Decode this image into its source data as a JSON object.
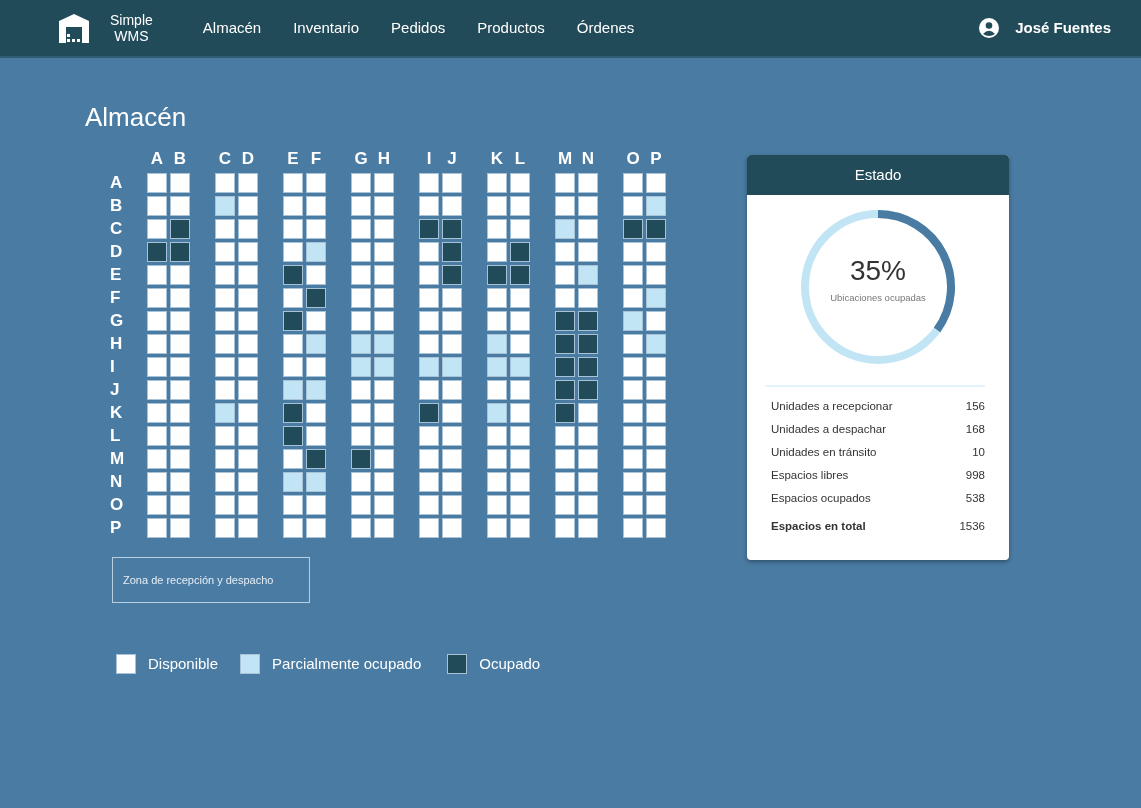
{
  "navbar": {
    "brand": [
      "Simple",
      "WMS"
    ],
    "links": [
      {
        "label": "Almacén",
        "selected": false
      },
      {
        "label": "Inventario",
        "selected": false
      },
      {
        "label": "Pedidos",
        "selected": false
      },
      {
        "label": "Productos",
        "selected": false
      },
      {
        "label": "Órdenes",
        "selected": false
      }
    ],
    "user": "José Fuentes"
  },
  "title": "Almacén",
  "grid": {
    "columns": [
      "A",
      "B",
      "C",
      "D",
      "E",
      "F",
      "G",
      "H",
      "I",
      "J",
      "K",
      "L",
      "M",
      "N",
      "O",
      "P"
    ],
    "rows": [
      {
        "label": "A",
        "cells": [
          {
            "color": "#ffffff"
          },
          {
            "color": "#ffffff"
          },
          {
            "color": "#ffffff"
          },
          {
            "color": "#ffffff"
          },
          {
            "color": "#ffffff"
          },
          {
            "color": "#ffffff"
          },
          {
            "color": "#ffffff"
          },
          {
            "color": "#ffffff"
          },
          {
            "color": "#ffffff"
          },
          {
            "color": "#ffffff"
          },
          {
            "color": "#ffffff"
          },
          {
            "color": "#ffffff"
          },
          {
            "color": "#ffffff"
          },
          {
            "color": "#ffffff"
          },
          {
            "color": "#ffffff"
          },
          {
            "color": "#ffffff"
          }
        ]
      },
      {
        "label": "B",
        "cells": [
          {
            "color": "#ffffff"
          },
          {
            "color": "#ffffff"
          },
          {
            "color": "#c2e5f6"
          },
          {
            "color": "#ffffff"
          },
          {
            "color": "#ffffff"
          },
          {
            "color": "#ffffff"
          },
          {
            "color": "#ffffff"
          },
          {
            "color": "#ffffff"
          },
          {
            "color": "#ffffff"
          },
          {
            "color": "#ffffff"
          },
          {
            "color": "#ffffff"
          },
          {
            "color": "#ffffff"
          },
          {
            "color": "#ffffff"
          },
          {
            "color": "#ffffff"
          },
          {
            "color": "#ffffff"
          },
          {
            "color": "#c2e5f6"
          }
        ]
      },
      {
        "label": "C",
        "cells": [
          {
            "color": "#ffffff"
          },
          {
            "color": "#224b5a"
          },
          {
            "color": "#ffffff"
          },
          {
            "color": "#ffffff"
          },
          {
            "color": "#ffffff"
          },
          {
            "color": "#ffffff"
          },
          {
            "color": "#ffffff"
          },
          {
            "color": "#ffffff"
          },
          {
            "color": "#224b5a"
          },
          {
            "color": "#224b5a"
          },
          {
            "color": "#ffffff"
          },
          {
            "color": "#ffffff"
          },
          {
            "color": "#c2e5f6"
          },
          {
            "color": "#ffffff"
          },
          {
            "color": "#224b5a"
          },
          {
            "color": "#224b5a"
          }
        ]
      },
      {
        "label": "D",
        "cells": [
          {
            "color": "#224b5a"
          },
          {
            "color": "#224b5a"
          },
          {
            "color": "#ffffff"
          },
          {
            "color": "#ffffff"
          },
          {
            "color": "#ffffff"
          },
          {
            "color": "#c2e5f6"
          },
          {
            "color": "#ffffff"
          },
          {
            "color": "#ffffff"
          },
          {
            "color": "#ffffff"
          },
          {
            "color": "#224b5a"
          },
          {
            "color": "#ffffff"
          },
          {
            "color": "#224b5a"
          },
          {
            "color": "#ffffff"
          },
          {
            "color": "#ffffff"
          },
          {
            "color": "#ffffff"
          },
          {
            "color": "#ffffff"
          }
        ]
      },
      {
        "label": "E",
        "cells": [
          {
            "color": "#ffffff"
          },
          {
            "color": "#ffffff"
          },
          {
            "color": "#ffffff"
          },
          {
            "color": "#ffffff"
          },
          {
            "color": "#224b5a"
          },
          {
            "color": "#ffffff"
          },
          {
            "color": "#ffffff"
          },
          {
            "color": "#ffffff"
          },
          {
            "color": "#ffffff"
          },
          {
            "color": "#224b5a"
          },
          {
            "color": "#224b5a"
          },
          {
            "color": "#224b5a"
          },
          {
            "color": "#ffffff"
          },
          {
            "color": "#c2e5f6"
          },
          {
            "color": "#ffffff"
          },
          {
            "color": "#ffffff"
          }
        ]
      },
      {
        "label": "F",
        "cells": [
          {
            "color": "#ffffff"
          },
          {
            "color": "#ffffff"
          },
          {
            "color": "#ffffff"
          },
          {
            "color": "#ffffff"
          },
          {
            "color": "#ffffff"
          },
          {
            "color": "#224b5a"
          },
          {
            "color": "#ffffff"
          },
          {
            "color": "#ffffff"
          },
          {
            "color": "#ffffff"
          },
          {
            "color": "#ffffff"
          },
          {
            "color": "#ffffff"
          },
          {
            "color": "#ffffff"
          },
          {
            "color": "#ffffff"
          },
          {
            "color": "#ffffff"
          },
          {
            "color": "#ffffff"
          },
          {
            "color": "#c2e5f6"
          }
        ]
      },
      {
        "label": "G",
        "cells": [
          {
            "color": "#ffffff"
          },
          {
            "color": "#ffffff"
          },
          {
            "color": "#ffffff"
          },
          {
            "color": "#ffffff"
          },
          {
            "color": "#224b5a"
          },
          {
            "color": "#ffffff"
          },
          {
            "color": "#ffffff"
          },
          {
            "color": "#ffffff"
          },
          {
            "color": "#ffffff"
          },
          {
            "color": "#ffffff"
          },
          {
            "color": "#ffffff"
          },
          {
            "color": "#ffffff"
          },
          {
            "color": "#224b5a"
          },
          {
            "color": "#224b5a"
          },
          {
            "color": "#c2e5f6"
          },
          {
            "color": "#ffffff"
          }
        ]
      },
      {
        "label": "H",
        "cells": [
          {
            "color": "#ffffff"
          },
          {
            "color": "#ffffff"
          },
          {
            "color": "#ffffff"
          },
          {
            "color": "#ffffff"
          },
          {
            "color": "#ffffff"
          },
          {
            "color": "#c2e5f6"
          },
          {
            "color": "#c2e5f6"
          },
          {
            "color": "#c2e5f6"
          },
          {
            "color": "#ffffff"
          },
          {
            "color": "#ffffff"
          },
          {
            "color": "#c2e5f6"
          },
          {
            "color": "#ffffff"
          },
          {
            "color": "#224b5a"
          },
          {
            "color": "#224b5a"
          },
          {
            "color": "#ffffff"
          },
          {
            "color": "#c2e5f6"
          }
        ]
      },
      {
        "label": "I",
        "cells": [
          {
            "color": "#ffffff"
          },
          {
            "color": "#ffffff"
          },
          {
            "color": "#ffffff"
          },
          {
            "color": "#ffffff"
          },
          {
            "color": "#ffffff"
          },
          {
            "color": "#ffffff"
          },
          {
            "color": "#c2e5f6"
          },
          {
            "color": "#c2e5f6"
          },
          {
            "color": "#c2e5f6"
          },
          {
            "color": "#c2e5f6"
          },
          {
            "color": "#c2e5f6"
          },
          {
            "color": "#c2e5f6"
          },
          {
            "color": "#224b5a"
          },
          {
            "color": "#224b5a"
          },
          {
            "color": "#ffffff"
          },
          {
            "color": "#ffffff"
          }
        ]
      },
      {
        "label": "J",
        "cells": [
          {
            "color": "#ffffff"
          },
          {
            "color": "#ffffff"
          },
          {
            "color": "#ffffff"
          },
          {
            "color": "#ffffff"
          },
          {
            "color": "#c2e5f6"
          },
          {
            "color": "#c2e5f6"
          },
          {
            "color": "#ffffff"
          },
          {
            "color": "#ffffff"
          },
          {
            "color": "#ffffff"
          },
          {
            "color": "#ffffff"
          },
          {
            "color": "#ffffff"
          },
          {
            "color": "#ffffff"
          },
          {
            "color": "#224b5a"
          },
          {
            "color": "#224b5a"
          },
          {
            "color": "#ffffff"
          },
          {
            "color": "#ffffff"
          }
        ]
      },
      {
        "label": "K",
        "cells": [
          {
            "color": "#ffffff"
          },
          {
            "color": "#ffffff"
          },
          {
            "color": "#c2e5f6"
          },
          {
            "color": "#ffffff"
          },
          {
            "color": "#224b5a"
          },
          {
            "color": "#ffffff"
          },
          {
            "color": "#ffffff"
          },
          {
            "color": "#ffffff"
          },
          {
            "color": "#224b5a"
          },
          {
            "color": "#ffffff"
          },
          {
            "color": "#c2e5f6"
          },
          {
            "color": "#ffffff"
          },
          {
            "color": "#224b5a"
          },
          {
            "color": "#ffffff"
          },
          {
            "color": "#ffffff"
          },
          {
            "color": "#ffffff"
          }
        ]
      },
      {
        "label": "L",
        "cells": [
          {
            "color": "#ffffff"
          },
          {
            "color": "#ffffff"
          },
          {
            "color": "#ffffff"
          },
          {
            "color": "#ffffff"
          },
          {
            "color": "#224b5a"
          },
          {
            "color": "#ffffff"
          },
          {
            "color": "#ffffff"
          },
          {
            "color": "#ffffff"
          },
          {
            "color": "#ffffff"
          },
          {
            "color": "#ffffff"
          },
          {
            "color": "#ffffff"
          },
          {
            "color": "#ffffff"
          },
          {
            "color": "#ffffff"
          },
          {
            "color": "#ffffff"
          },
          {
            "color": "#ffffff"
          },
          {
            "color": "#ffffff"
          }
        ]
      },
      {
        "label": "M",
        "cells": [
          {
            "color": "#ffffff"
          },
          {
            "color": "#ffffff"
          },
          {
            "color": "#ffffff"
          },
          {
            "color": "#ffffff"
          },
          {
            "color": "#ffffff"
          },
          {
            "color": "#224b5a"
          },
          {
            "color": "#224b5a"
          },
          {
            "color": "#ffffff"
          },
          {
            "color": "#ffffff"
          },
          {
            "color": "#ffffff"
          },
          {
            "color": "#ffffff"
          },
          {
            "color": "#ffffff"
          },
          {
            "color": "#ffffff"
          },
          {
            "color": "#ffffff"
          },
          {
            "color": "#ffffff"
          },
          {
            "color": "#ffffff"
          }
        ]
      },
      {
        "label": "N",
        "cells": [
          {
            "color": "#ffffff"
          },
          {
            "color": "#ffffff"
          },
          {
            "color": "#ffffff"
          },
          {
            "color": "#ffffff"
          },
          {
            "color": "#c2e5f6"
          },
          {
            "color": "#c2e5f6"
          },
          {
            "color": "#ffffff"
          },
          {
            "color": "#ffffff"
          },
          {
            "color": "#ffffff"
          },
          {
            "color": "#ffffff"
          },
          {
            "color": "#ffffff"
          },
          {
            "color": "#ffffff"
          },
          {
            "color": "#ffffff"
          },
          {
            "color": "#ffffff"
          },
          {
            "color": "#ffffff"
          },
          {
            "color": "#ffffff"
          }
        ]
      },
      {
        "label": "O",
        "cells": [
          {
            "color": "#ffffff"
          },
          {
            "color": "#ffffff"
          },
          {
            "color": "#ffffff"
          },
          {
            "color": "#ffffff"
          },
          {
            "color": "#ffffff"
          },
          {
            "color": "#ffffff"
          },
          {
            "color": "#ffffff"
          },
          {
            "color": "#ffffff"
          },
          {
            "color": "#ffffff"
          },
          {
            "color": "#ffffff"
          },
          {
            "color": "#ffffff"
          },
          {
            "color": "#ffffff"
          },
          {
            "color": "#ffffff"
          },
          {
            "color": "#ffffff"
          },
          {
            "color": "#ffffff"
          },
          {
            "color": "#ffffff"
          }
        ]
      },
      {
        "label": "P",
        "cells": [
          {
            "color": "#ffffff"
          },
          {
            "color": "#ffffff"
          },
          {
            "color": "#ffffff"
          },
          {
            "color": "#ffffff"
          },
          {
            "color": "#ffffff"
          },
          {
            "color": "#ffffff"
          },
          {
            "color": "#ffffff"
          },
          {
            "color": "#ffffff"
          },
          {
            "color": "#ffffff"
          },
          {
            "color": "#ffffff"
          },
          {
            "color": "#ffffff"
          },
          {
            "color": "#ffffff"
          },
          {
            "color": "#ffffff"
          },
          {
            "color": "#ffffff"
          },
          {
            "color": "#ffffff"
          },
          {
            "color": "#ffffff"
          }
        ]
      }
    ]
  },
  "zone": "Zona de recepción y despacho",
  "legend": [
    {
      "color": "#ffffff",
      "label": "Disponible"
    },
    {
      "color": "#c2e5f6",
      "label": "Parcialmente ocupado"
    },
    {
      "color": "#224b5a",
      "label": "Ocupado"
    }
  ],
  "status_card": {
    "title": "Estado",
    "percent": "35%",
    "caption": "Ubicaciones ocupadas",
    "stats": [
      {
        "label": "Unidades a recepcionar",
        "value": "156",
        "total": false
      },
      {
        "label": "Unidades a despachar",
        "value": "168",
        "total": false
      },
      {
        "label": "Unidades en tránsito",
        "value": "10",
        "total": false
      },
      {
        "label": "Espacios libres",
        "value": "998",
        "total": false
      },
      {
        "label": "Espacios ocupados",
        "value": "538",
        "total": false
      },
      {
        "label": "Espacios en total",
        "value": "1536",
        "total": true
      }
    ]
  }
}
